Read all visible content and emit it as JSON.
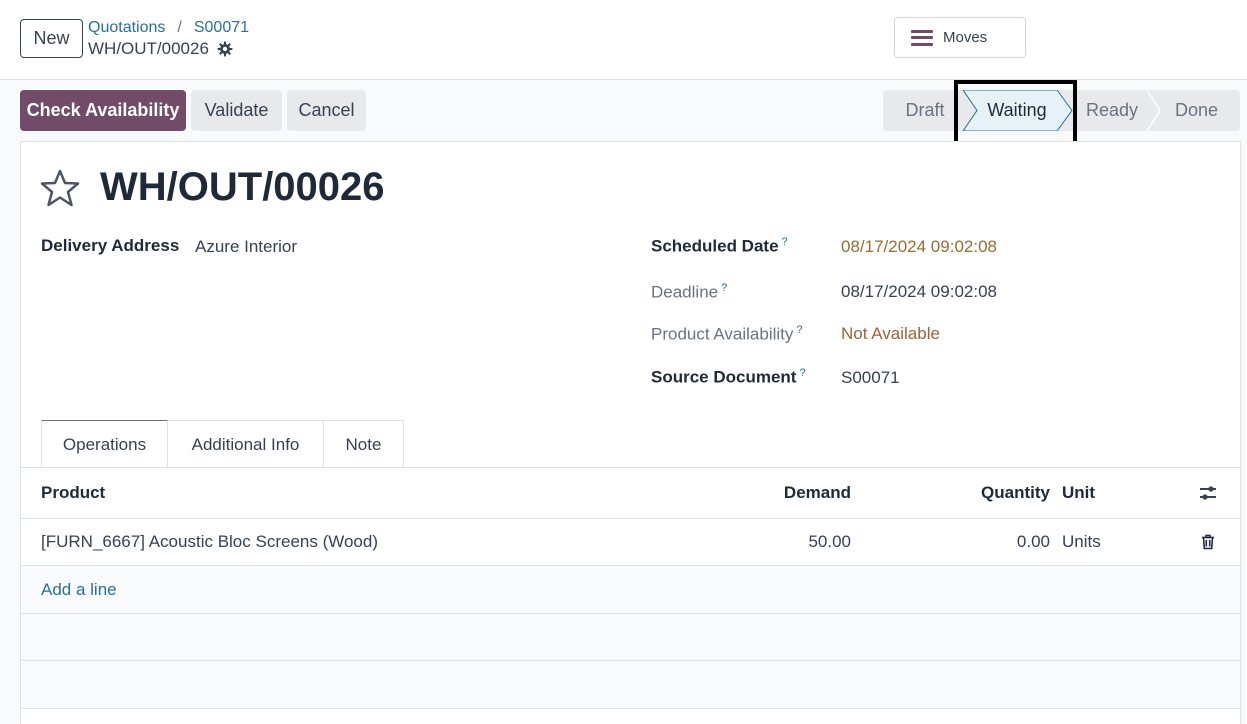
{
  "control_panel": {
    "new_label": "New",
    "breadcrumb": [
      "Quotations",
      "S00071"
    ],
    "current": "WH/OUT/00026",
    "moves_label": "Moves"
  },
  "actions": {
    "check_availability": "Check Availability",
    "validate": "Validate",
    "cancel": "Cancel"
  },
  "stages": {
    "items": [
      "Draft",
      "Waiting",
      "Ready",
      "Done"
    ],
    "current": "Waiting"
  },
  "record": {
    "title": "WH/OUT/00026",
    "delivery_address_label": "Delivery Address",
    "delivery_address": "Azure Interior",
    "scheduled_date_label": "Scheduled Date",
    "scheduled_date": "08/17/2024 09:02:08",
    "deadline_label": "Deadline",
    "deadline": "08/17/2024 09:02:08",
    "availability_label": "Product Availability",
    "availability": "Not Available",
    "source_label": "Source Document",
    "source": "S00071",
    "help_mark": "?"
  },
  "tabs": [
    "Operations",
    "Additional Info",
    "Note"
  ],
  "table": {
    "headers": {
      "product": "Product",
      "demand": "Demand",
      "quantity": "Quantity",
      "unit": "Unit"
    },
    "rows": [
      {
        "product": "[FURN_6667] Acoustic Bloc Screens (Wood)",
        "demand": "50.00",
        "quantity": "0.00",
        "unit": "Units"
      }
    ],
    "add_line": "Add a line"
  },
  "colors": {
    "brand": "#714b67",
    "link": "#2a6f97",
    "warning": "#9a6b32"
  }
}
